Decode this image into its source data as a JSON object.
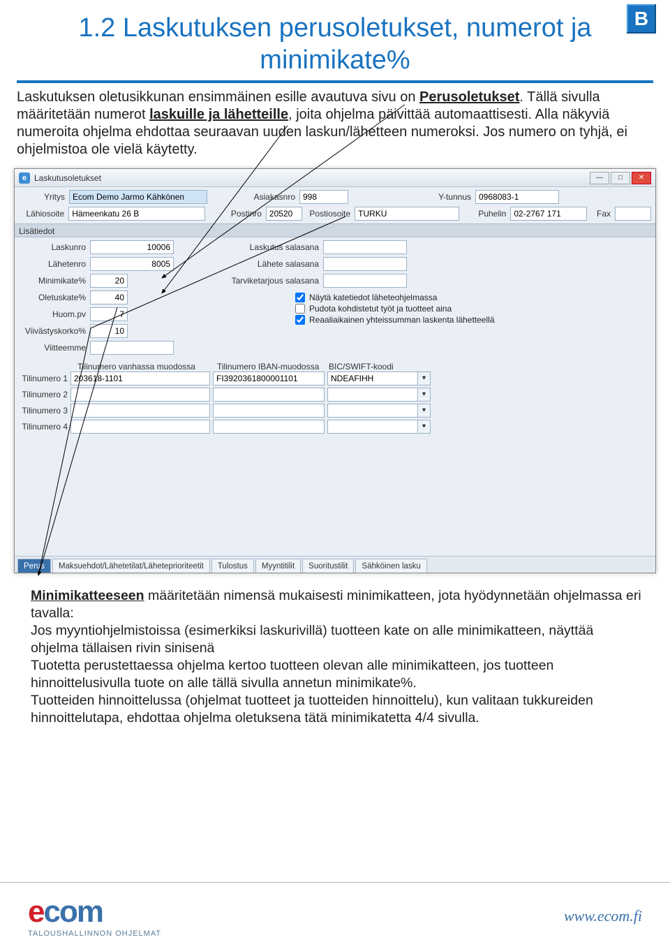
{
  "badge": "B",
  "title": "1.2 Laskutuksen perusoletukset, numerot ja minimikate%",
  "intro": {
    "t1": "Laskutuksen oletusikkunan ensimmäinen esille avautuva sivu on ",
    "perus": "Perusoletukset",
    "t2": ". Tällä sivulla määritetään numerot ",
    "laskuille": "laskuille  ja ",
    "lahetteille": "lähetteille",
    "t3": ", joita ohjelma päivittää automaattisesti. Alla näkyviä numeroita ohjelma ehdottaa seuraavan uuden laskun/lähetteen numeroksi. Jos numero on tyhjä, ei ohjelmistoa ole vielä käytetty."
  },
  "window": {
    "title": "Laskutusoletukset",
    "top": {
      "yritys_lbl": "Yritys",
      "yritys": "Ecom Demo Jarmo Kähkönen",
      "asiakasnro_lbl": "Asiakasnro",
      "asiakasnro": "998",
      "ytunnus_lbl": "Y-tunnus",
      "ytunnus": "0968083-1",
      "lahiosoite_lbl": "Lähiosoite",
      "lahiosoite": "Hämeenkatu 26 B",
      "postinro_lbl": "Postinro",
      "postinro": "20520",
      "postiosoite_lbl": "Postiosoite",
      "postiosoite": "TURKU",
      "puhelin_lbl": "Puhelin",
      "puhelin": "02-2767 171",
      "fax_lbl": "Fax",
      "fax": ""
    },
    "section": "Lisätiedot",
    "left": {
      "laskunro_lbl": "Laskunro",
      "laskunro": "10006",
      "lahetenro_lbl": "Lähetenro",
      "lahetenro": "8005",
      "minimikate_lbl": "Minimikate%",
      "minimikate": "20",
      "oletuskate_lbl": "Oletuskate%",
      "oletuskate": "40",
      "huompv_lbl": "Huom.pv",
      "huompv": "7",
      "viivkorko_lbl": "Viivästyskorko%",
      "viivkorko": "10",
      "viitteemme_lbl": "Viitteemme",
      "viitteemme": ""
    },
    "passwords": {
      "laskutus_lbl": "Laskutus salasana",
      "lahete_lbl": "Lähete salasana",
      "tarjous_lbl": "Tarviketarjous salasana"
    },
    "checks": {
      "katetiedot": "Näytä katetiedot läheteohjelmassa",
      "pudota": "Pudota kohdistetut työt ja tuotteet aina",
      "reaali": "Reaaliaikainen yhteissumman laskenta lähetteellä"
    },
    "tili_head": {
      "vanhassa": "Tilinumero vanhassa muodossa",
      "iban": "Tilinumero IBAN-muodossa",
      "bic": "BIC/SWIFT-koodi"
    },
    "tili": [
      {
        "lbl": "Tilinumero 1",
        "old": "203618-1101",
        "iban": "FI3920361800001101",
        "bic": "NDEAFIHH"
      },
      {
        "lbl": "Tilinumero 2",
        "old": "",
        "iban": "",
        "bic": ""
      },
      {
        "lbl": "Tilinumero 3",
        "old": "",
        "iban": "",
        "bic": ""
      },
      {
        "lbl": "Tilinumero 4",
        "old": "",
        "iban": "",
        "bic": ""
      }
    ],
    "tabs": [
      "Perus",
      "Maksuehdot/Lähetetilat/Läheteprioriteetit",
      "Tulostus",
      "Myyntitilit",
      "Suoritustilit",
      "Sähköinen lasku"
    ]
  },
  "body": {
    "mk": "Minimikatteeseen",
    "p1": " määritetään nimensä mukaisesti minimikatteen, jota hyödynnetään ohjelmassa eri tavalla:",
    "p2": "Jos myyntiohjelmistoissa (esimerkiksi laskurivillä) tuotteen kate on alle minimikatteen, näyttää ohjelma tällaisen rivin sinisenä",
    "p3": "Tuotetta perustettaessa ohjelma kertoo tuotteen olevan alle minimikatteen, jos tuotteen hinnoittelusivulla tuote on alle tällä sivulla annetun minimikate%.",
    "p4": "Tuotteiden hinnoittelussa (ohjelmat tuotteet ja tuotteiden hinnoittelu), kun valitaan tukkureiden hinnoittelutapa, ehdottaa ohjelma oletuksena tätä minimikatetta  4/4 sivulla."
  },
  "footer": {
    "e": "e",
    "com": "com",
    "sub": "TALOUSHALLINNON OHJELMAT",
    "url": "www.ecom.fi"
  }
}
